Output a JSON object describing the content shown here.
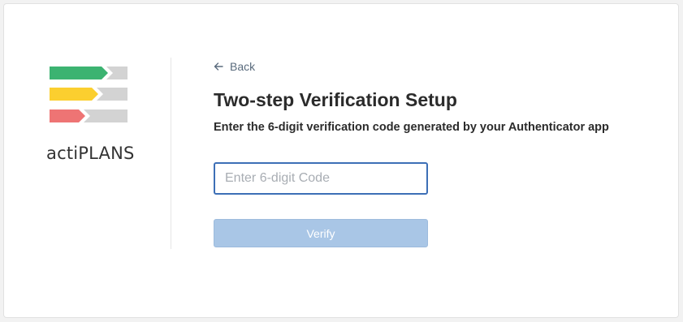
{
  "brand": {
    "name": "actiPLANS",
    "colors": {
      "green": "#3cb371",
      "yellow": "#fbcf2f",
      "red": "#ee7474",
      "gray": "#d3d3d3"
    }
  },
  "nav": {
    "back_label": "Back",
    "back_icon": "arrow-left-icon"
  },
  "main": {
    "title": "Two-step Verification Setup",
    "subtitle": "Enter the 6-digit verification code generated by your Authenticator app"
  },
  "form": {
    "code_placeholder": "Enter 6-digit Code",
    "code_value": "",
    "verify_label": "Verify",
    "verify_disabled": true,
    "accent_color": "#3d6fb6",
    "button_color": "#a9c6e6"
  }
}
